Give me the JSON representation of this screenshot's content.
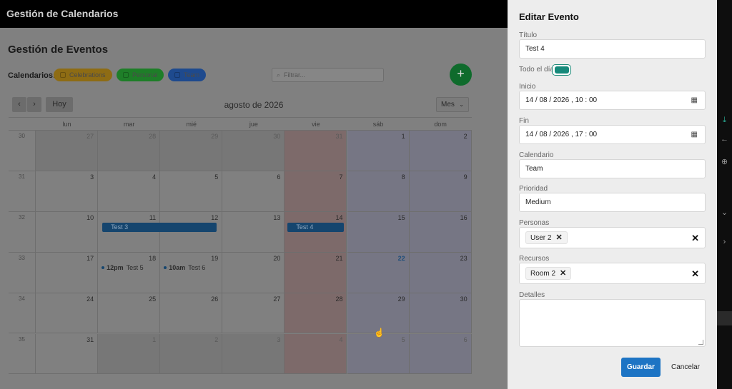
{
  "app": {
    "title": "Gestión de Calendarios"
  },
  "main": {
    "page_title": "Gestión de Eventos",
    "calendars_label": "Calendarios:",
    "calendars": [
      {
        "label": "Celebrations",
        "color": "#f0b323"
      },
      {
        "label": "Personal",
        "color": "#2fbf3e"
      },
      {
        "label": "Team",
        "color": "#3b82f6"
      }
    ],
    "filter_placeholder": "Filtrar...",
    "add_label": "+",
    "toolbar": {
      "prev": "‹",
      "next": "›",
      "today": "Hoy",
      "month_title": "agosto de 2026",
      "view": "Mes"
    },
    "weekdays": [
      "lun",
      "mar",
      "mié",
      "jue",
      "vie",
      "sáb",
      "dom"
    ],
    "weeks": [
      {
        "wk": "30",
        "days": [
          "27",
          "28",
          "29",
          "30",
          "31",
          "1",
          "2"
        ]
      },
      {
        "wk": "31",
        "days": [
          "3",
          "4",
          "5",
          "6",
          "7",
          "8",
          "9"
        ]
      },
      {
        "wk": "32",
        "days": [
          "10",
          "11",
          "12",
          "13",
          "14",
          "15",
          "16"
        ]
      },
      {
        "wk": "33",
        "days": [
          "17",
          "18",
          "19",
          "20",
          "21",
          "22",
          "23"
        ]
      },
      {
        "wk": "34",
        "days": [
          "24",
          "25",
          "26",
          "27",
          "28",
          "29",
          "30"
        ]
      },
      {
        "wk": "35",
        "days": [
          "31",
          "1",
          "2",
          "3",
          "4",
          "5",
          "6"
        ]
      }
    ],
    "events": {
      "test3": "Test 3",
      "test4": "Test 4",
      "test5_time": "12pm",
      "test5": "Test 5",
      "test6_time": "10am",
      "test6": "Test 6"
    }
  },
  "drawer": {
    "title": "Editar Evento",
    "titulo_label": "Título",
    "titulo_value": "Test 4",
    "allday_label": "Todo el día",
    "allday_on": true,
    "inicio_label": "Inicio",
    "inicio_value": "14 / 08 / 2026 ,  10 : 00",
    "fin_label": "Fin",
    "fin_value": "14 / 08 / 2026 ,  17 : 00",
    "calendario_label": "Calendario",
    "calendario_value": "Team",
    "prioridad_label": "Prioridad",
    "prioridad_value": "Medium",
    "personas_label": "Personas",
    "personas_tag": "User 2",
    "recursos_label": "Recursos",
    "recursos_tag": "Room 2",
    "detalles_label": "Detalles",
    "save_label": "Guardar",
    "cancel_label": "Cancelar"
  }
}
